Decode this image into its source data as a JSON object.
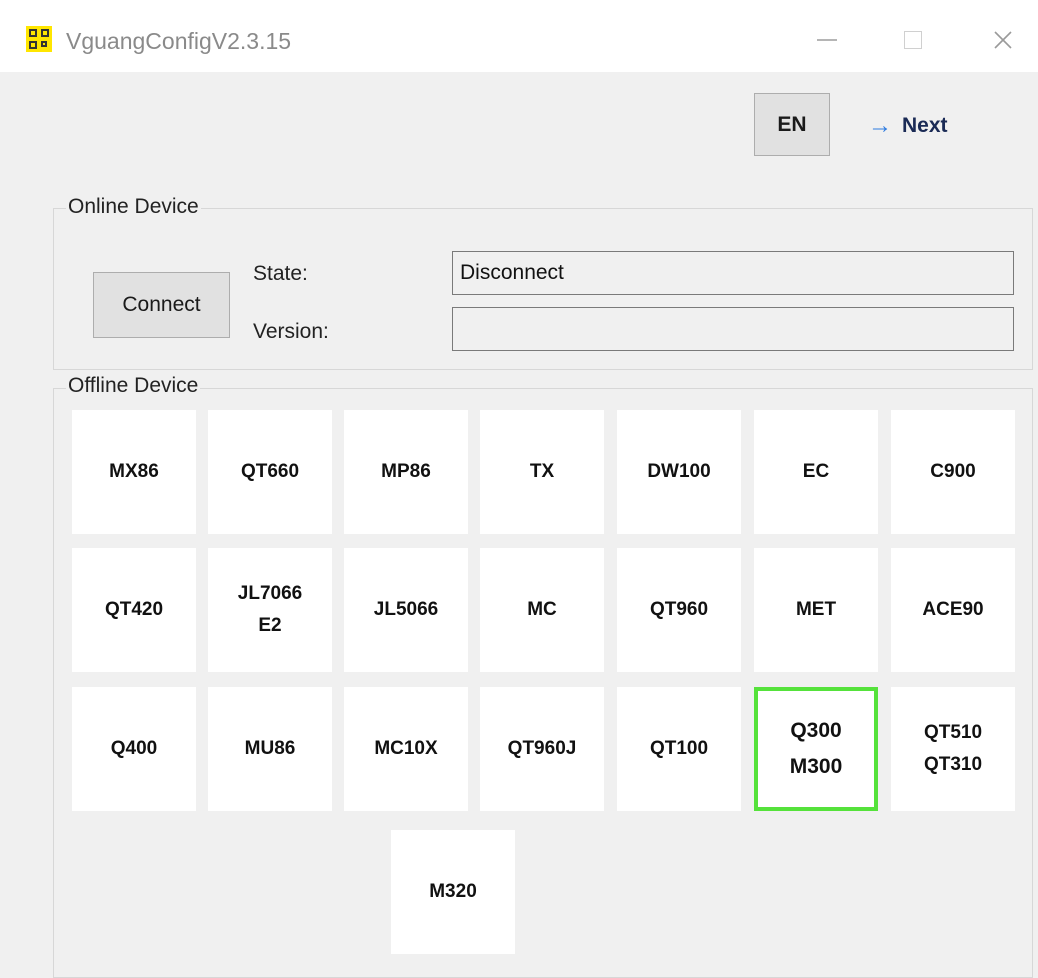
{
  "window": {
    "title": "VguangConfigV2.3.15",
    "icon": "qr-app-icon"
  },
  "toolbar": {
    "lang_label": "EN",
    "next_label": "Next",
    "next_icon": "arrow-right-icon"
  },
  "online": {
    "legend": "Online Device",
    "connect_label": "Connect",
    "state_label": "State:",
    "version_label": "Version:",
    "state_value": "Disconnect",
    "version_value": ""
  },
  "offline": {
    "legend": "Offline Device",
    "devices": [
      "MX86",
      "QT660",
      "MP86",
      "TX",
      "DW100",
      "EC",
      "C900",
      "QT420",
      "JL7066\nE2",
      "JL5066",
      "MC",
      "QT960",
      "MET",
      "ACE90",
      "Q400",
      "MU86",
      "MC10X",
      "QT960J",
      "QT100",
      "Q300\nM300",
      "QT510\nQT310",
      "M320"
    ],
    "selected_device": "Q300\nM300"
  },
  "colors": {
    "selected_border": "#55e23b",
    "next_arrow": "#2e7be0",
    "app_icon": "#ffe600"
  }
}
